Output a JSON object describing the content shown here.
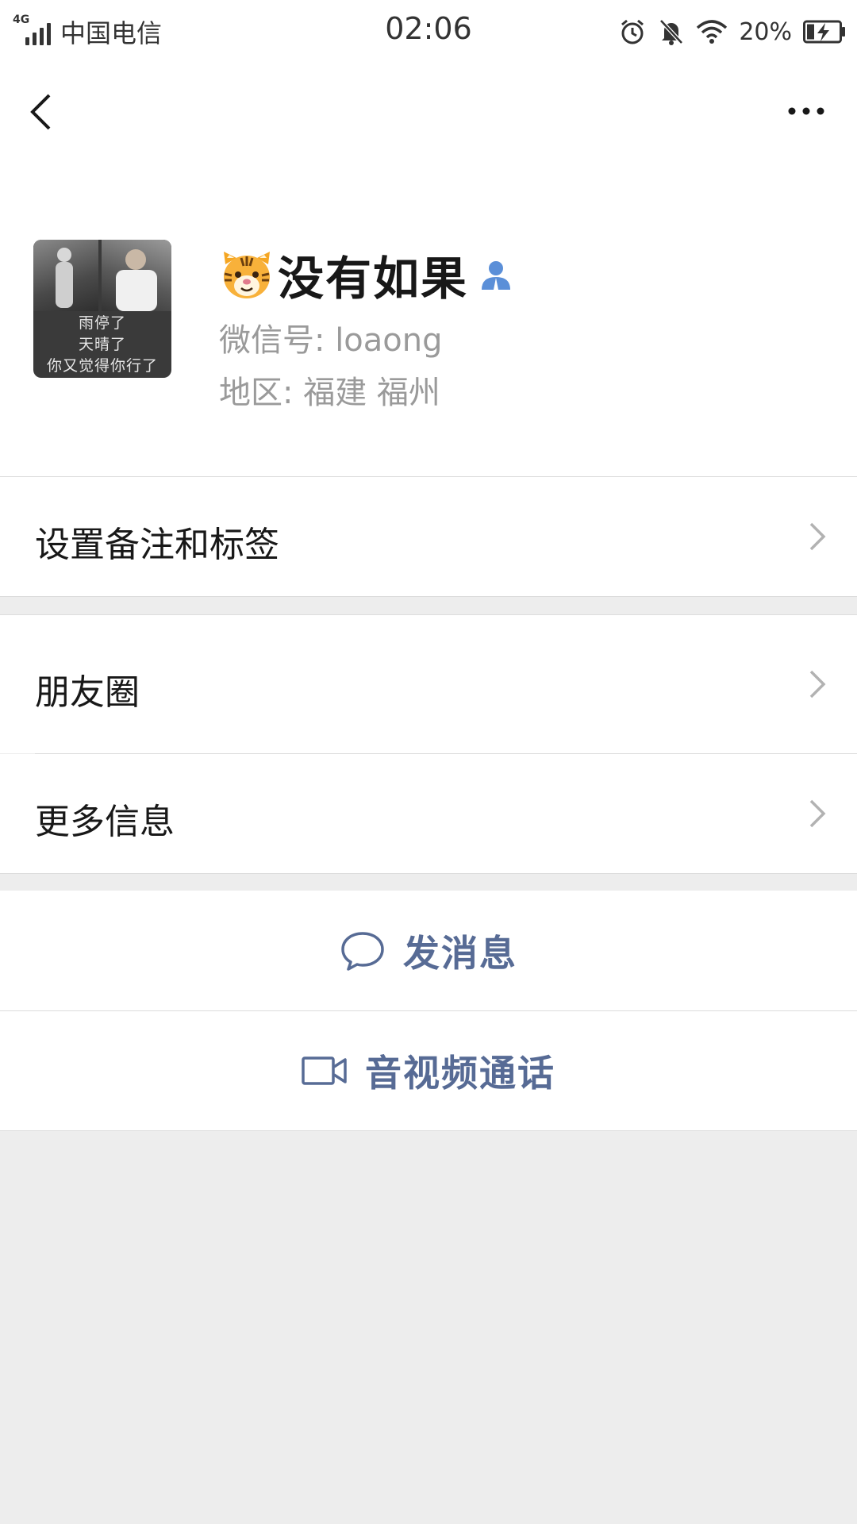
{
  "status_bar": {
    "network": "4G",
    "carrier": "中国电信",
    "time": "02:06",
    "battery": "20%",
    "icons": [
      "alarm-icon",
      "mute-bell-icon",
      "wifi-icon",
      "battery-charging-icon"
    ]
  },
  "nav": {
    "back_icon": "chevron-left-icon",
    "more_icon": "more-dots-icon"
  },
  "profile": {
    "avatar_caption": [
      "雨停了",
      "天晴了",
      "你又觉得你行了"
    ],
    "nickname_emoji": "🐯",
    "nickname": "没有如果",
    "wechat_id": "微信号: loaong",
    "region": "地区: 福建  福州"
  },
  "menu": {
    "remark_tags": "设置备注和标签",
    "moments": "朋友圈",
    "more_info": "更多信息"
  },
  "actions": {
    "send_message": "发消息",
    "video_call": "音视频通话"
  },
  "colors": {
    "link": "#576b95",
    "background": "#ededed",
    "contact_icon": "#5b8fd8"
  }
}
